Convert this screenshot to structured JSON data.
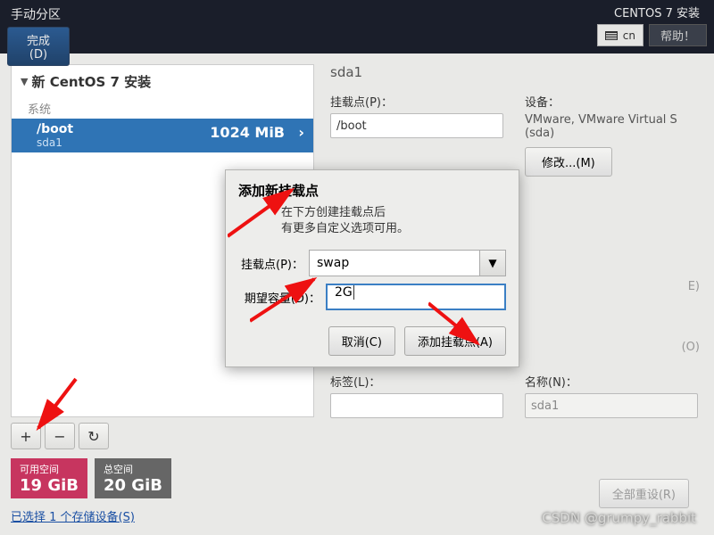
{
  "header": {
    "title": "手动分区",
    "done_label": "完成(D)",
    "subtitle": "CENTOS 7 安装",
    "keyboard": "cn",
    "help_label": "帮助！"
  },
  "left": {
    "tree_title": "新 CentOS 7 安装",
    "group_label": "系统",
    "item": {
      "mount": "/boot",
      "device": "sda1",
      "size": "1024 MiB"
    },
    "buttons": {
      "add": "+",
      "remove": "−",
      "reload": "↻"
    },
    "space": {
      "avail_label": "可用空间",
      "avail_value": "19 GiB",
      "total_label": "总空间",
      "total_value": "20 GiB"
    },
    "storage_link": "已选择 1 个存储设备(S)"
  },
  "right": {
    "title": "sda1",
    "mount_label": "挂载点(P)：",
    "mount_value": "/boot",
    "device_label": "设备：",
    "device_text": "VMware, VMware Virtual S (sda)",
    "modify_label": "修改...(M)",
    "label_label": "标签(L)：",
    "label_value": "",
    "name_label": "名称(N)：",
    "name_value": "sda1",
    "stray_e": "E)",
    "stray_o": "(O)",
    "reset_label": "全部重设(R)"
  },
  "dialog": {
    "title": "添加新挂载点",
    "desc_line1": "在下方创建挂载点后",
    "desc_line2": "有更多自定义选项可用。",
    "mount_label": "挂载点(P)：",
    "mount_value": "swap",
    "capacity_label": "期望容量(D)：",
    "capacity_value": "2G",
    "cancel_label": "取消(C)",
    "add_label": "添加挂载点(A)"
  },
  "watermark": "CSDN @grumpy_rabbit"
}
